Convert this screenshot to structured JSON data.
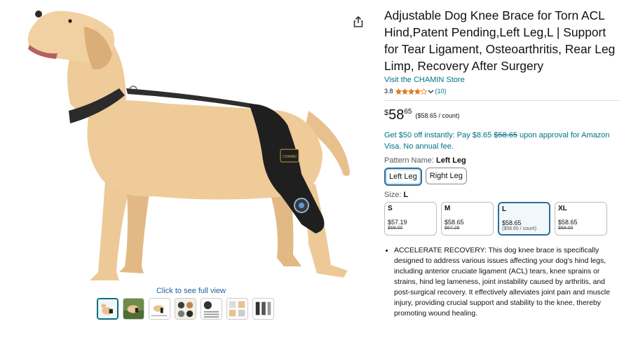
{
  "gallery": {
    "full_view_link": "Click to see full view",
    "brace_brand_text": "CHAMIN",
    "thumbnails": [
      {
        "icon": "dog-sitting-thumb-icon"
      },
      {
        "icon": "dog-outdoor-thumb-icon"
      },
      {
        "icon": "brace-diagram-thumb-icon"
      },
      {
        "icon": "features-thumb-icon"
      },
      {
        "icon": "size-chart-thumb-icon"
      },
      {
        "icon": "info-thumb-icon"
      },
      {
        "icon": "components-thumb-icon"
      }
    ]
  },
  "product": {
    "title": "Adjustable Dog Knee Brace for Torn ACL Hind,Patent Pending,Left Leg,L | Support for Tear Ligament, Osteoarthritis, Rear Leg Limp, Recovery After Surgery",
    "store_link": "Visit the CHAMIN Store",
    "rating": "3.8",
    "rating_value": 3.8,
    "rating_count": "(10)",
    "price_symbol": "$",
    "price_whole": "58",
    "price_fraction": "65",
    "price_unit": "($58.65 / count)",
    "promo_prefix": "Get $50 off instantly: Pay $8.65 ",
    "promo_strike": "$58.65",
    "promo_suffix": " upon approval for Amazon Visa. No annual fee.",
    "pattern_label": "Pattern Name: ",
    "pattern_value": "Left Leg",
    "pattern_options": [
      "Left Leg",
      "Right Leg"
    ],
    "size_label": "Size: ",
    "size_value": "L",
    "sizes": [
      {
        "name": "S",
        "price": "$57.19",
        "sub": "$69.00"
      },
      {
        "name": "M",
        "price": "$58.65",
        "sub": "$67.28"
      },
      {
        "name": "L",
        "price": "$58.65",
        "sub": "($58.65 / count)"
      },
      {
        "name": "XL",
        "price": "$58.65",
        "sub": "$69.00"
      }
    ],
    "bullets": [
      "ACCELERATE RECOVERY: This dog knee brace is specifically designed to address various issues affecting your dog's hind legs, including anterior cruciate ligament (ACL) tears, knee sprains or strains, hind leg lameness, joint instability caused by arthritis, and post-surgical recovery. It effectively alleviates joint pain and muscle injury, providing crucial support and stability to the knee, thereby promoting wound healing."
    ]
  },
  "colors": {
    "link": "#007185",
    "star": "#de7921",
    "selected_border": "#2f6c97"
  }
}
